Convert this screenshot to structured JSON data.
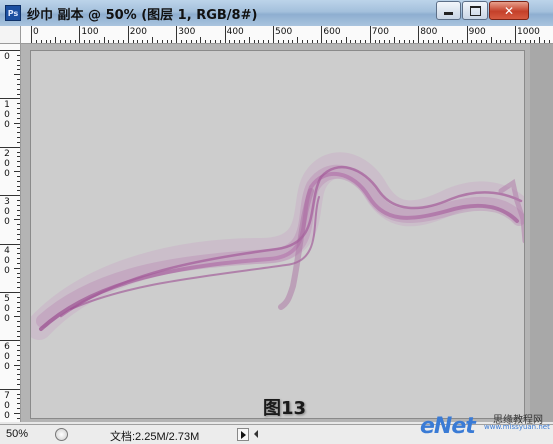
{
  "window": {
    "app_icon": "Ps",
    "title": "纱巾 副本 @ 50% (图层 1, RGB/8#)",
    "controls": {
      "minimize_icon": "minimize-icon",
      "maximize_icon": "maximize-icon",
      "close_icon": "close-icon"
    }
  },
  "rulers": {
    "top_labels": [
      "0",
      "100",
      "200",
      "300",
      "400",
      "500",
      "600",
      "700",
      "800",
      "900",
      "1000"
    ],
    "left_labels": [
      "0",
      "100",
      "200",
      "300",
      "400",
      "500",
      "600",
      "700"
    ]
  },
  "canvas": {
    "background_color": "#cdcdcd",
    "ribbon_color": "#b06aa8",
    "caption": "图13"
  },
  "statusbar": {
    "zoom": "50%",
    "doc_info": "文档:2.25M/2.73M"
  },
  "watermark": {
    "brand": "eNet",
    "subtitle": "思缘教程网",
    "url": "www.missyuan.net"
  }
}
